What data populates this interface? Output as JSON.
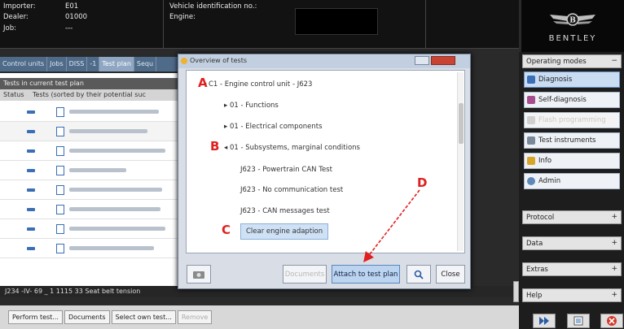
{
  "header": {
    "importer_label": "Importer:",
    "importer_value": "E01",
    "dealer_label": "Dealer:",
    "dealer_value": "01000",
    "job_label": "Job:",
    "job_value": "---",
    "vin_label": "Vehicle identification no.:",
    "engine_label": "Engine:"
  },
  "brand": {
    "name": "BENTLEY"
  },
  "tabs": [
    "Control units",
    "Jobs",
    "DISS",
    "-1",
    "Test plan",
    "Sequ"
  ],
  "left_panel": {
    "section_title": "Tests in current test plan",
    "columns": [
      "Status",
      "Tests (sorted by their potential suc"
    ]
  },
  "dialog": {
    "title": "Overview of tests",
    "tree": [
      "C1 - Engine control unit - J623",
      "01 - Functions",
      "01 - Electrical components",
      "01 - Subsystems, marginal conditions",
      "J623 - Powertrain CAN Test",
      "J623 - No communication test",
      "J623 - CAN messages test",
      "Clear engine adaption"
    ],
    "markers": {
      "a": "A",
      "b": "B",
      "c": "C",
      "d": "D"
    },
    "buttons": {
      "documents": "Documents",
      "attach": "Attach to test plan",
      "close": "Close"
    }
  },
  "status_line": "J234 -IV- 69 _ 1 1115 33 Seat belt tension",
  "bottom_buttons": [
    "Perform test...",
    "Documents",
    "Select own test...",
    "Remove"
  ],
  "right_panel": {
    "sections": {
      "operating_modes": "Operating modes",
      "protocol": "Protocol",
      "data": "Data",
      "extras": "Extras",
      "help": "Help"
    },
    "items": {
      "diagnosis": "Diagnosis",
      "self_diagnosis": "Self-diagnosis",
      "flash": "Flash programming",
      "test_instruments": "Test instruments",
      "info": "Info",
      "admin": "Admin"
    }
  },
  "colors": {
    "accent": "#3a6eb5",
    "marker": "#e01f1f",
    "dark_bg": "#121212"
  }
}
